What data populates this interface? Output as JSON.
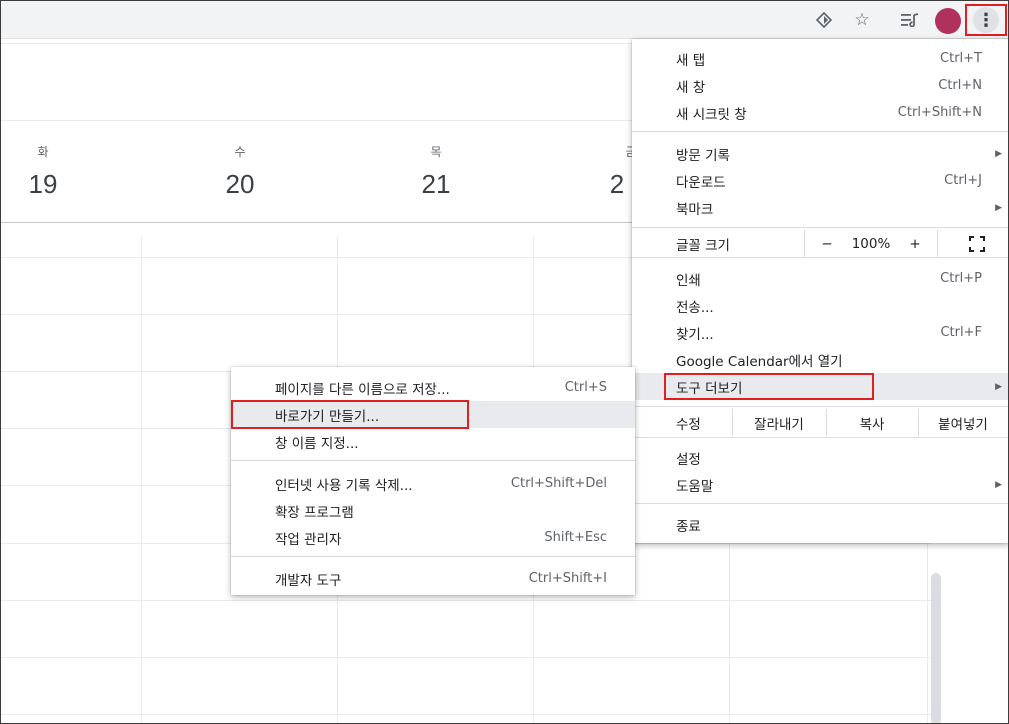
{
  "toolbar": {
    "icons": [
      "extension-icon",
      "bookmark-star-icon",
      "reading-list-icon",
      "profile-avatar",
      "more-menu-icon"
    ],
    "avatar_color": "#b0325c",
    "kebab_glyph": "⋮"
  },
  "calendar": {
    "days": [
      {
        "name": "화",
        "num": "19"
      },
      {
        "name": "수",
        "num": "20"
      },
      {
        "name": "목",
        "num": "21"
      },
      {
        "name": "금",
        "num": "2"
      }
    ]
  },
  "main_menu": {
    "new_tab": {
      "label": "새 탭",
      "shortcut": "Ctrl+T"
    },
    "new_window": {
      "label": "새 창",
      "shortcut": "Ctrl+N"
    },
    "incognito": {
      "label": "새 시크릿 창",
      "shortcut": "Ctrl+Shift+N"
    },
    "history": {
      "label": "방문 기록"
    },
    "downloads": {
      "label": "다운로드",
      "shortcut": "Ctrl+J"
    },
    "bookmarks": {
      "label": "북마크"
    },
    "zoom": {
      "label": "글꼴 크기",
      "minus": "−",
      "value": "100%",
      "plus": "+"
    },
    "print": {
      "label": "인쇄",
      "shortcut": "Ctrl+P"
    },
    "cast": {
      "label": "전송..."
    },
    "find": {
      "label": "찾기...",
      "shortcut": "Ctrl+F"
    },
    "open_in": {
      "label": "Google Calendar에서 열기"
    },
    "more_tools": {
      "label": "도구 더보기"
    },
    "edit": {
      "label": "수정",
      "cut": "잘라내기",
      "copy": "복사",
      "paste": "붙여넣기"
    },
    "settings": {
      "label": "설정"
    },
    "help": {
      "label": "도움말"
    },
    "exit": {
      "label": "종료"
    }
  },
  "sub_menu": {
    "save_page": {
      "label": "페이지를 다른 이름으로 저장...",
      "shortcut": "Ctrl+S"
    },
    "create_shortcut": {
      "label": "바로가기 만들기..."
    },
    "name_window": {
      "label": "창 이름 지정..."
    },
    "clear_data": {
      "label": "인터넷 사용 기록 삭제...",
      "shortcut": "Ctrl+Shift+Del"
    },
    "extensions": {
      "label": "확장 프로그램"
    },
    "task_manager": {
      "label": "작업 관리자",
      "shortcut": "Shift+Esc"
    },
    "dev_tools": {
      "label": "개발자 도구",
      "shortcut": "Ctrl+Shift+I"
    }
  },
  "colors": {
    "highlight_box": "#e02020",
    "hover": "#e8eaed"
  }
}
